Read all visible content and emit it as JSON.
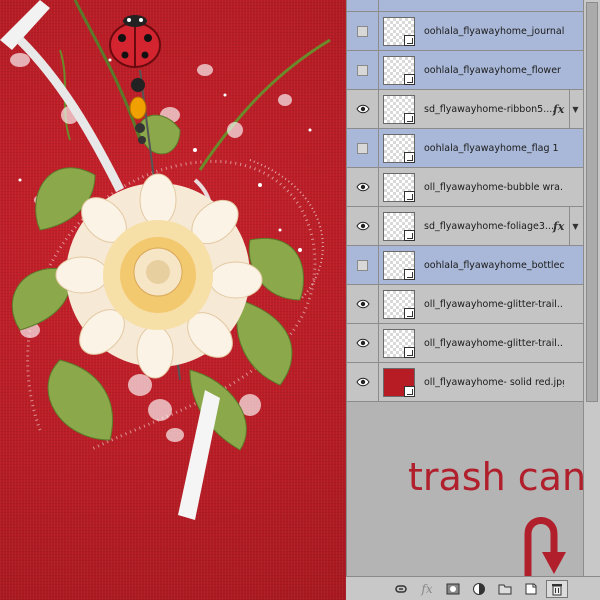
{
  "layers": [
    {
      "name": "",
      "visible": false,
      "selected": true,
      "fx": false,
      "thumb": "transparent"
    },
    {
      "name": "oohlala_flyawayhome_journal...",
      "visible": false,
      "selected": true,
      "fx": false,
      "thumb": "transparent"
    },
    {
      "name": "oohlala_flyawayhome_flower ...",
      "visible": false,
      "selected": true,
      "fx": false,
      "thumb": "transparent"
    },
    {
      "name": "sd_flyawayhome-ribbon5....",
      "visible": true,
      "selected": false,
      "fx": true,
      "thumb": "transparent"
    },
    {
      "name": "oohlala_flyawayhome_flag 1",
      "visible": false,
      "selected": true,
      "fx": false,
      "thumb": "transparent"
    },
    {
      "name": "oll_flyawayhome-bubble wra...",
      "visible": true,
      "selected": false,
      "fx": false,
      "thumb": "transparent"
    },
    {
      "name": "sd_flyawayhome-foliage3....",
      "visible": true,
      "selected": false,
      "fx": true,
      "thumb": "transparent"
    },
    {
      "name": "oohlala_flyawayhome_bottlec...",
      "visible": false,
      "selected": true,
      "fx": false,
      "thumb": "transparent"
    },
    {
      "name": "oll_flyawayhome-glitter-trail....",
      "visible": true,
      "selected": false,
      "fx": false,
      "thumb": "transparent"
    },
    {
      "name": "oll_flyawayhome-glitter-trail....",
      "visible": true,
      "selected": false,
      "fx": false,
      "thumb": "transparent"
    },
    {
      "name": "oll_flyawayhome- solid red.jpg",
      "visible": true,
      "selected": false,
      "fx": false,
      "thumb": "red"
    }
  ],
  "fx_label": "fx",
  "annotation": {
    "text": "trash can",
    "color": "#b01f2b"
  },
  "toolbar": [
    {
      "icon": "link-layers-icon",
      "label": ""
    },
    {
      "icon": "layer-style-fx-icon",
      "label": "fx"
    },
    {
      "icon": "layer-mask-icon",
      "label": ""
    },
    {
      "icon": "adjustment-layer-icon",
      "label": ""
    },
    {
      "icon": "new-group-folder-icon",
      "label": ""
    },
    {
      "icon": "new-layer-icon",
      "label": ""
    },
    {
      "icon": "trash-can-icon",
      "label": ""
    }
  ],
  "colors": {
    "canvas_red": "#b71c25",
    "selected_row": "#a9b8d8",
    "panel_bg": "#b4b4b4"
  }
}
